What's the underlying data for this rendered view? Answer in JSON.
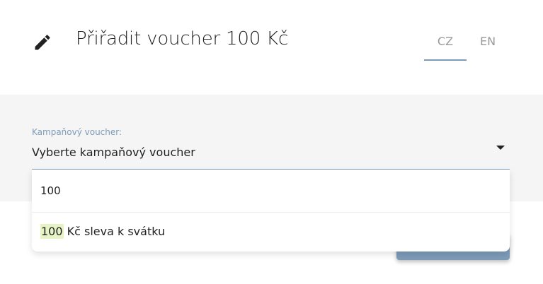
{
  "header": {
    "icon": "pencil-icon",
    "title": "Přiřadit voucher 100 Kč",
    "languages": [
      {
        "label": "CZ",
        "active": true
      },
      {
        "label": "EN",
        "active": false
      }
    ]
  },
  "form": {
    "field_label": "Kampaňový voucher:",
    "select_value": "Vyberte kampaňový voucher",
    "search_value": "100",
    "options": [
      {
        "match": "100",
        "rest": " Kč sleva k svátku"
      }
    ]
  },
  "colors": {
    "accent": "#7d9bb8",
    "panel_bg": "#f5f5f5",
    "highlight": "#e6f3c5"
  }
}
